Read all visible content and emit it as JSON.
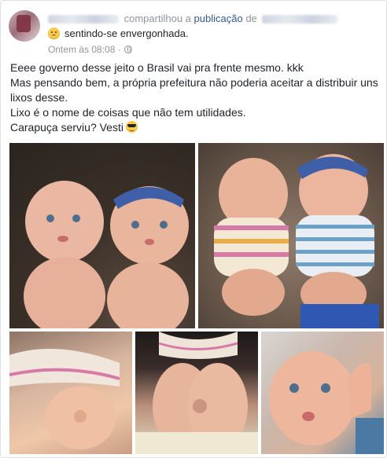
{
  "post": {
    "action_text": "compartilhou a",
    "link_text": "publicação",
    "link_suffix": "de",
    "feeling_text": "sentindo-se envergonhada.",
    "timestamp": "Ontem às 08:08 ·",
    "body_lines": [
      "Eeee governo desse jeito o Brasil vai pra frente mesmo. kkk",
      "Mas pensando bem, a própria prefeitura não poderia aceitar a distribuir uns lixos desse.",
      "Lixo é o nome de coisas que não tem utilidades.",
      "Carapuça serviu? Vesti"
    ]
  },
  "icons": {
    "feeling": "embarrassed-face-icon",
    "privacy": "globe-icon",
    "emoji": "sunglasses-face-icon"
  },
  "colors": {
    "link": "#365899",
    "meta": "#90949c",
    "text": "#1d2129"
  }
}
